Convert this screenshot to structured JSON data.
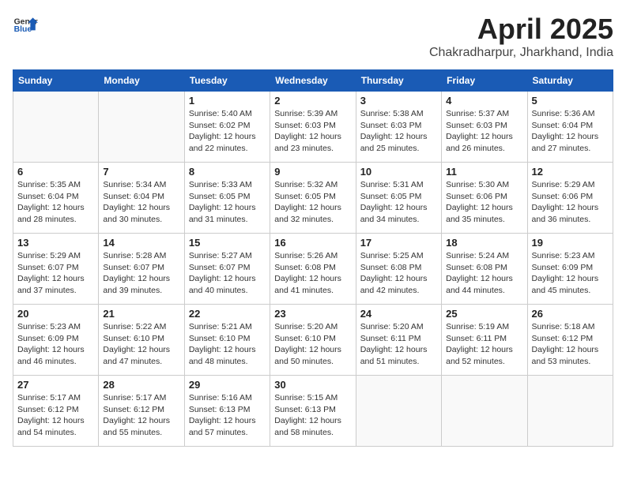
{
  "header": {
    "logo_general": "General",
    "logo_blue": "Blue",
    "month": "April 2025",
    "location": "Chakradharpur, Jharkhand, India"
  },
  "weekdays": [
    "Sunday",
    "Monday",
    "Tuesday",
    "Wednesday",
    "Thursday",
    "Friday",
    "Saturday"
  ],
  "weeks": [
    [
      {
        "day": "",
        "info": ""
      },
      {
        "day": "",
        "info": ""
      },
      {
        "day": "1",
        "info": "Sunrise: 5:40 AM\nSunset: 6:02 PM\nDaylight: 12 hours and 22 minutes."
      },
      {
        "day": "2",
        "info": "Sunrise: 5:39 AM\nSunset: 6:03 PM\nDaylight: 12 hours and 23 minutes."
      },
      {
        "day": "3",
        "info": "Sunrise: 5:38 AM\nSunset: 6:03 PM\nDaylight: 12 hours and 25 minutes."
      },
      {
        "day": "4",
        "info": "Sunrise: 5:37 AM\nSunset: 6:03 PM\nDaylight: 12 hours and 26 minutes."
      },
      {
        "day": "5",
        "info": "Sunrise: 5:36 AM\nSunset: 6:04 PM\nDaylight: 12 hours and 27 minutes."
      }
    ],
    [
      {
        "day": "6",
        "info": "Sunrise: 5:35 AM\nSunset: 6:04 PM\nDaylight: 12 hours and 28 minutes."
      },
      {
        "day": "7",
        "info": "Sunrise: 5:34 AM\nSunset: 6:04 PM\nDaylight: 12 hours and 30 minutes."
      },
      {
        "day": "8",
        "info": "Sunrise: 5:33 AM\nSunset: 6:05 PM\nDaylight: 12 hours and 31 minutes."
      },
      {
        "day": "9",
        "info": "Sunrise: 5:32 AM\nSunset: 6:05 PM\nDaylight: 12 hours and 32 minutes."
      },
      {
        "day": "10",
        "info": "Sunrise: 5:31 AM\nSunset: 6:05 PM\nDaylight: 12 hours and 34 minutes."
      },
      {
        "day": "11",
        "info": "Sunrise: 5:30 AM\nSunset: 6:06 PM\nDaylight: 12 hours and 35 minutes."
      },
      {
        "day": "12",
        "info": "Sunrise: 5:29 AM\nSunset: 6:06 PM\nDaylight: 12 hours and 36 minutes."
      }
    ],
    [
      {
        "day": "13",
        "info": "Sunrise: 5:29 AM\nSunset: 6:07 PM\nDaylight: 12 hours and 37 minutes."
      },
      {
        "day": "14",
        "info": "Sunrise: 5:28 AM\nSunset: 6:07 PM\nDaylight: 12 hours and 39 minutes."
      },
      {
        "day": "15",
        "info": "Sunrise: 5:27 AM\nSunset: 6:07 PM\nDaylight: 12 hours and 40 minutes."
      },
      {
        "day": "16",
        "info": "Sunrise: 5:26 AM\nSunset: 6:08 PM\nDaylight: 12 hours and 41 minutes."
      },
      {
        "day": "17",
        "info": "Sunrise: 5:25 AM\nSunset: 6:08 PM\nDaylight: 12 hours and 42 minutes."
      },
      {
        "day": "18",
        "info": "Sunrise: 5:24 AM\nSunset: 6:08 PM\nDaylight: 12 hours and 44 minutes."
      },
      {
        "day": "19",
        "info": "Sunrise: 5:23 AM\nSunset: 6:09 PM\nDaylight: 12 hours and 45 minutes."
      }
    ],
    [
      {
        "day": "20",
        "info": "Sunrise: 5:23 AM\nSunset: 6:09 PM\nDaylight: 12 hours and 46 minutes."
      },
      {
        "day": "21",
        "info": "Sunrise: 5:22 AM\nSunset: 6:10 PM\nDaylight: 12 hours and 47 minutes."
      },
      {
        "day": "22",
        "info": "Sunrise: 5:21 AM\nSunset: 6:10 PM\nDaylight: 12 hours and 48 minutes."
      },
      {
        "day": "23",
        "info": "Sunrise: 5:20 AM\nSunset: 6:10 PM\nDaylight: 12 hours and 50 minutes."
      },
      {
        "day": "24",
        "info": "Sunrise: 5:20 AM\nSunset: 6:11 PM\nDaylight: 12 hours and 51 minutes."
      },
      {
        "day": "25",
        "info": "Sunrise: 5:19 AM\nSunset: 6:11 PM\nDaylight: 12 hours and 52 minutes."
      },
      {
        "day": "26",
        "info": "Sunrise: 5:18 AM\nSunset: 6:12 PM\nDaylight: 12 hours and 53 minutes."
      }
    ],
    [
      {
        "day": "27",
        "info": "Sunrise: 5:17 AM\nSunset: 6:12 PM\nDaylight: 12 hours and 54 minutes."
      },
      {
        "day": "28",
        "info": "Sunrise: 5:17 AM\nSunset: 6:12 PM\nDaylight: 12 hours and 55 minutes."
      },
      {
        "day": "29",
        "info": "Sunrise: 5:16 AM\nSunset: 6:13 PM\nDaylight: 12 hours and 57 minutes."
      },
      {
        "day": "30",
        "info": "Sunrise: 5:15 AM\nSunset: 6:13 PM\nDaylight: 12 hours and 58 minutes."
      },
      {
        "day": "",
        "info": ""
      },
      {
        "day": "",
        "info": ""
      },
      {
        "day": "",
        "info": ""
      }
    ]
  ]
}
